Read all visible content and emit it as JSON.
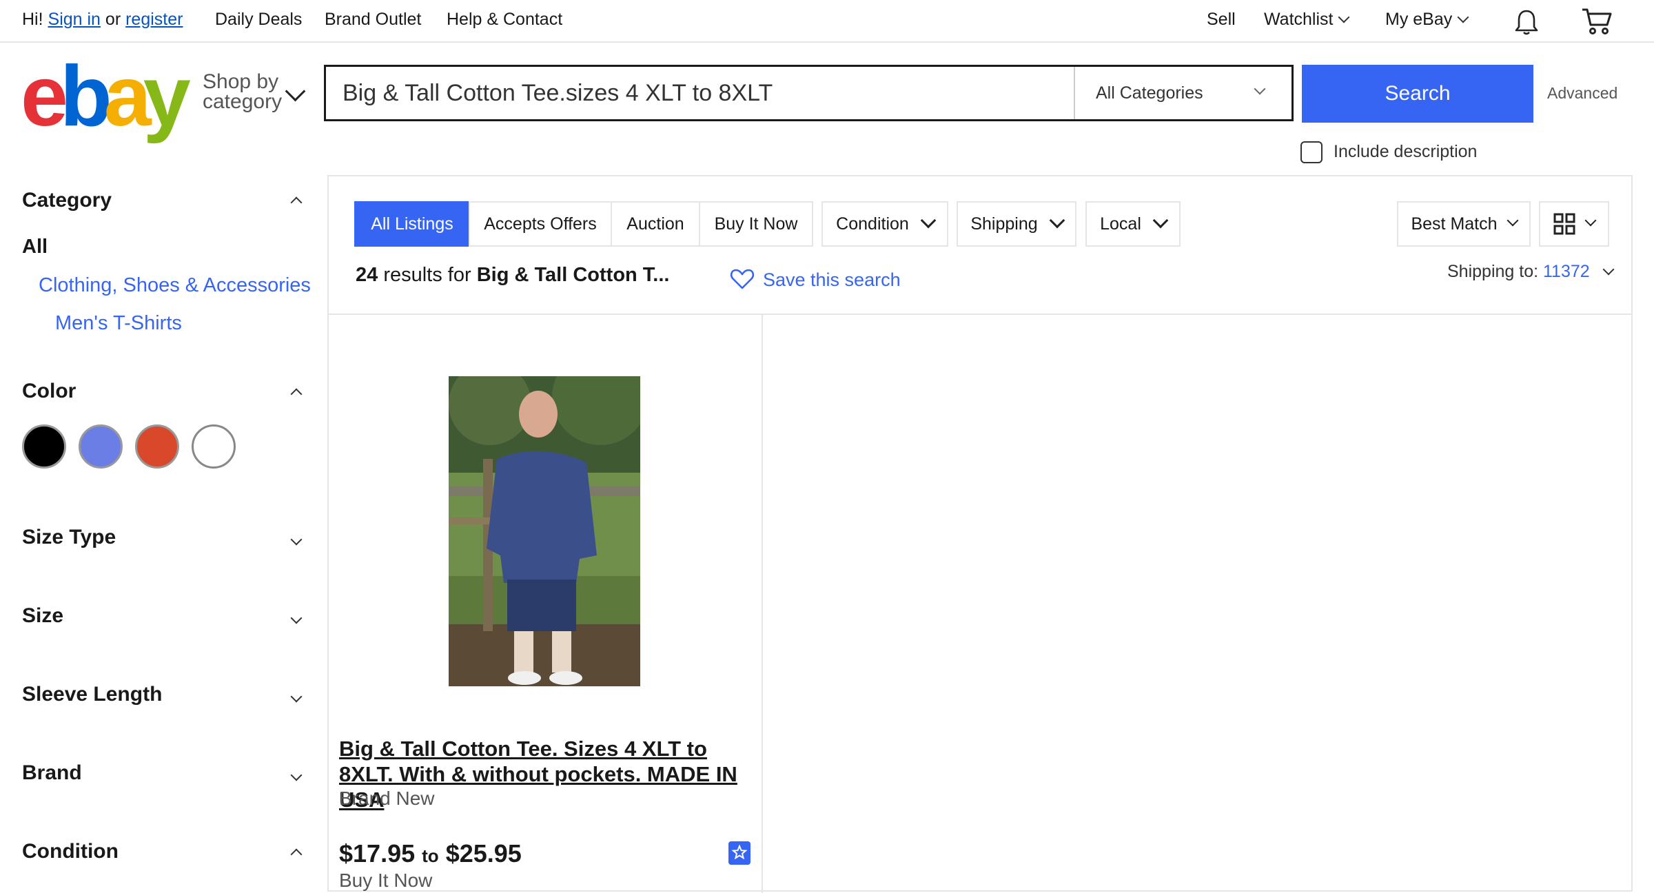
{
  "topbar": {
    "greeting": "Hi!",
    "sign_in": "Sign in",
    "or": "or",
    "register": "register",
    "links": [
      "Daily Deals",
      "Brand Outlet",
      "Help & Contact"
    ],
    "sell": "Sell",
    "watchlist": "Watchlist",
    "my_ebay": "My eBay"
  },
  "header": {
    "logo_letters": [
      "e",
      "b",
      "a",
      "y"
    ],
    "logo_colors": [
      "#e53238",
      "#0064d2",
      "#f5af02",
      "#86b817"
    ],
    "shop_by_line1": "Shop by",
    "shop_by_line2": "category",
    "search_value": "Big & Tall Cotton Tee.sizes 4 XLT to 8XLT",
    "category_select": "All Categories",
    "search_button": "Search",
    "advanced": "Advanced",
    "include_description": "Include description"
  },
  "sidebar": {
    "category_heading": "Category",
    "category_all": "All",
    "category_items": [
      "Clothing, Shoes & Accessories",
      "Men's T-Shirts"
    ],
    "color_heading": "Color",
    "colors": [
      "#000000",
      "#6b7ee6",
      "#d9482a",
      "#ffffff"
    ],
    "sections": [
      "Size Type",
      "Size",
      "Sleeve Length",
      "Brand",
      "Condition"
    ]
  },
  "filters": {
    "tabs": [
      "All Listings",
      "Accepts Offers",
      "Auction",
      "Buy It Now"
    ],
    "dropdowns": [
      "Condition",
      "Shipping",
      "Local"
    ],
    "sort": "Best Match"
  },
  "results": {
    "count": "24",
    "count_text": "results for",
    "query_short": "Big & Tall Cotton T...",
    "save_search": "Save this search",
    "shipping_to_label": "Shipping to:",
    "shipping_zip": "11372"
  },
  "product": {
    "title": "Big & Tall Cotton Tee. Sizes 4 XLT to 8XLT. With & without pockets. MADE IN USA",
    "condition": "Brand New",
    "price_low": "$17.95",
    "price_to": "to",
    "price_high": "$25.95",
    "buy_format": "Buy It Now"
  }
}
